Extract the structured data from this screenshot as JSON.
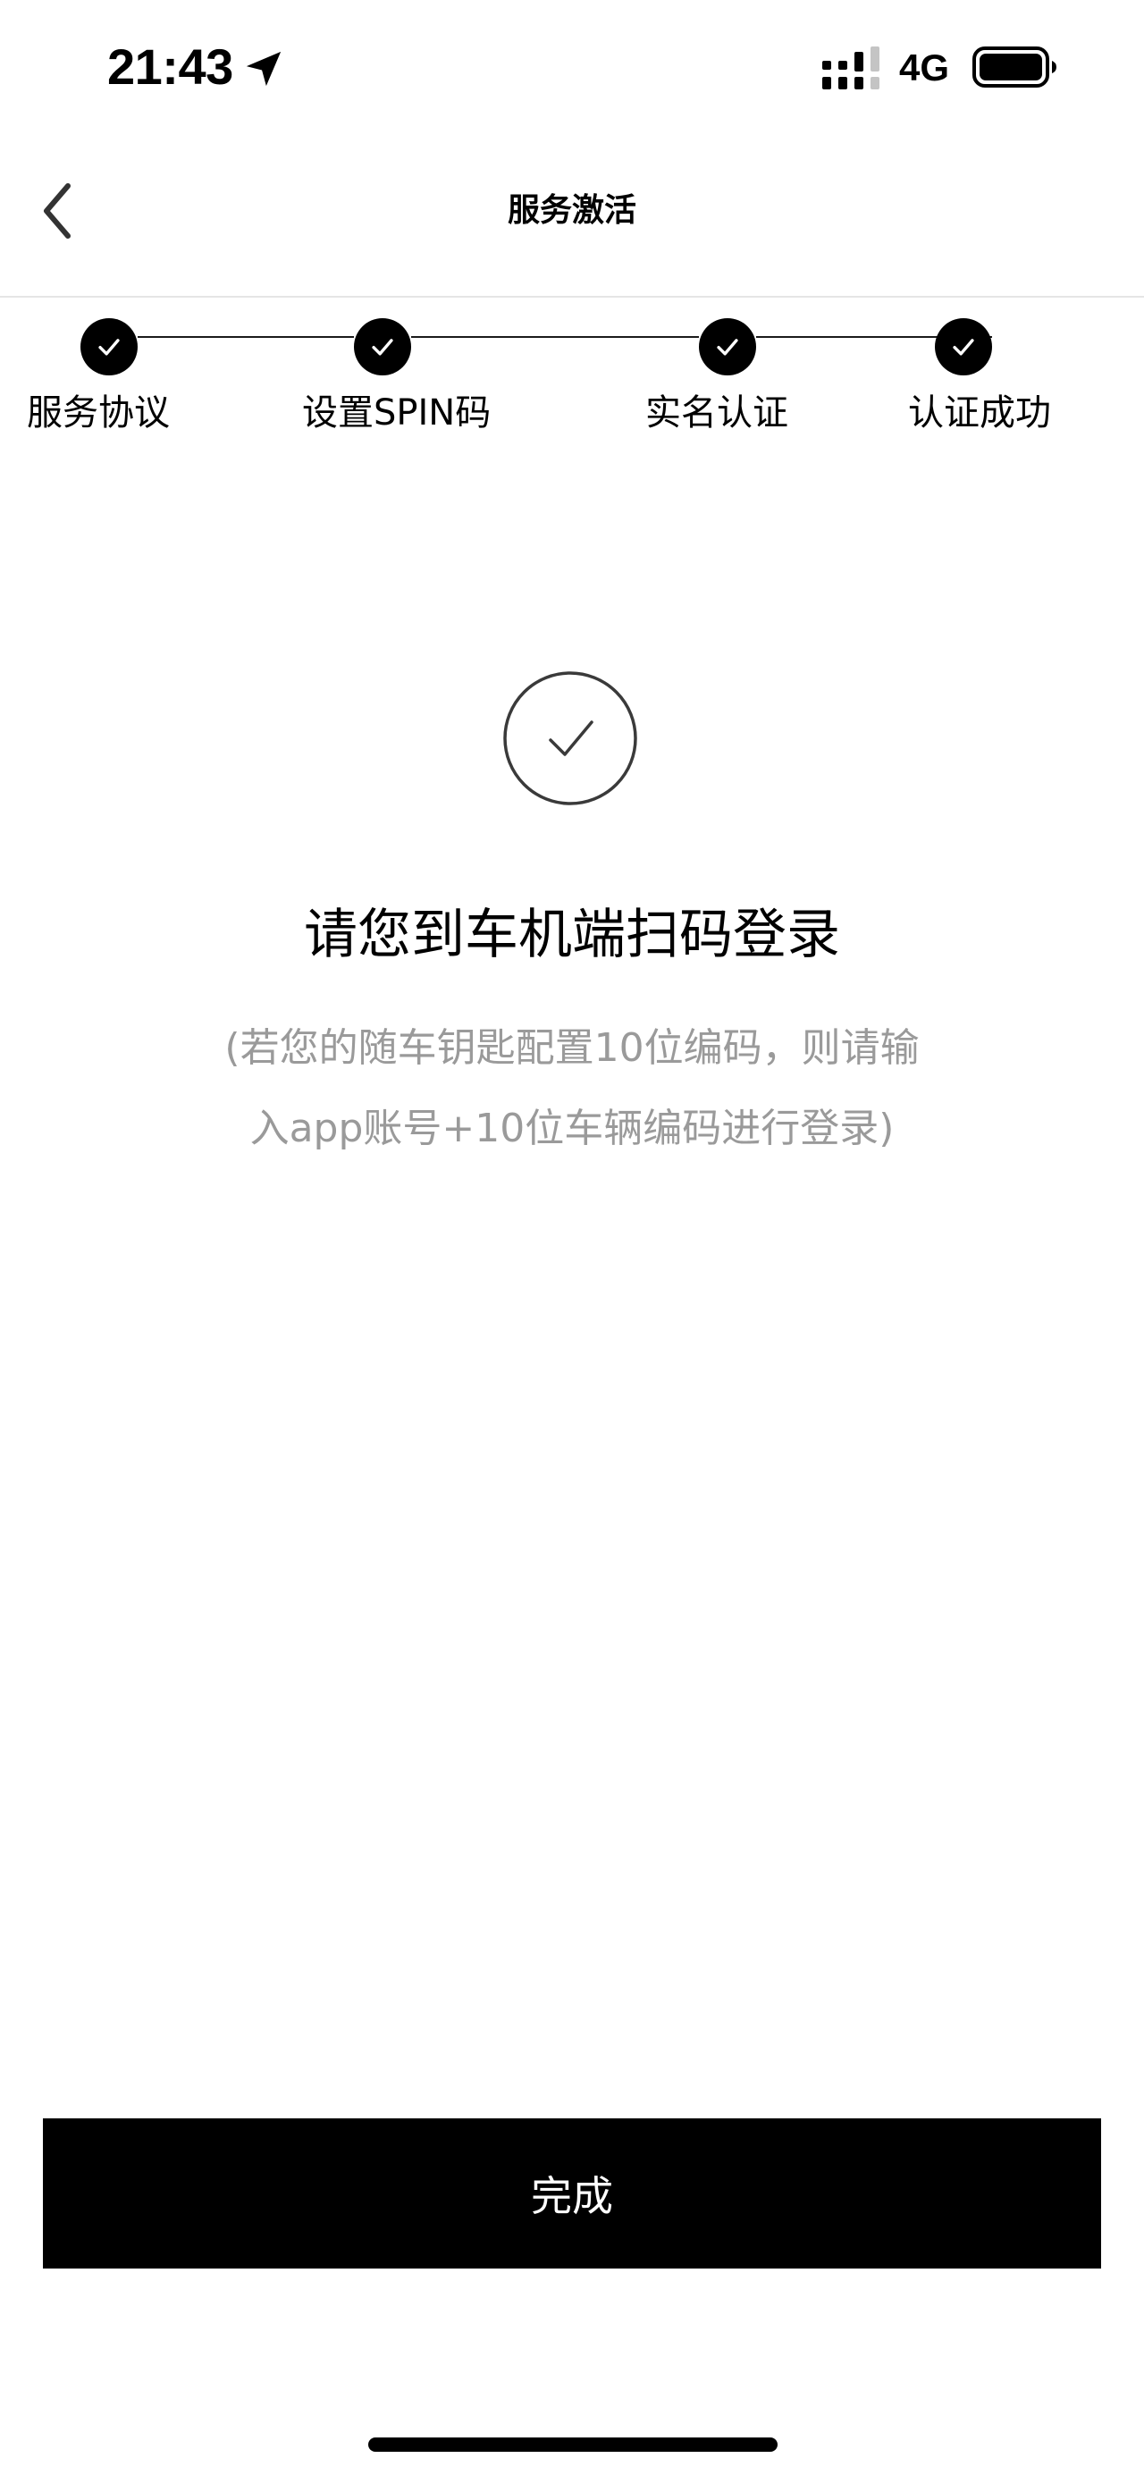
{
  "status_bar": {
    "time": "21:43",
    "network": "4G",
    "icons": [
      "location-arrow-icon",
      "cellular-signal-icon",
      "battery-icon"
    ]
  },
  "nav": {
    "title": "服务激活",
    "back_icon": "chevron-left-icon"
  },
  "stepper": {
    "steps": [
      {
        "label": "服务协议",
        "status": "completed"
      },
      {
        "label": "设置SPIN码",
        "status": "completed"
      },
      {
        "label": "实名认证",
        "status": "completed"
      },
      {
        "label": "认证成功",
        "status": "completed"
      }
    ],
    "icon": "checkmark-icon"
  },
  "result": {
    "icon": "success-check-circle-icon",
    "message": "请您到车机端扫码登录",
    "hint_line1": "(若您的随车钥匙配置10位编码，则请输",
    "hint_line2": "入app账号+10位车辆编码进行登录)"
  },
  "actions": {
    "done_label": "完成"
  },
  "colors": {
    "primary": "#000000",
    "background": "#ffffff",
    "hint_text": "#9a9a9a",
    "divider": "#e5e5e5"
  }
}
